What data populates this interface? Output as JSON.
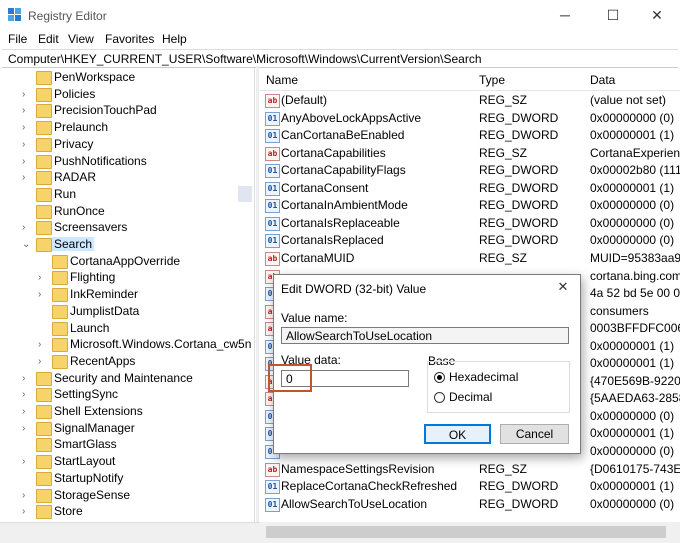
{
  "window": {
    "title": "Registry Editor",
    "minimize": "─",
    "maximize": "☐",
    "close": "✕"
  },
  "menu": [
    "File",
    "Edit",
    "View",
    "Favorites",
    "Help"
  ],
  "address": "Computer\\HKEY_CURRENT_USER\\Software\\Microsoft\\Windows\\CurrentVersion\\Search",
  "tree": [
    {
      "label": "PenWorkspace",
      "level": 0,
      "expandable": false
    },
    {
      "label": "Policies",
      "level": 0,
      "expandable": true
    },
    {
      "label": "PrecisionTouchPad",
      "level": 0,
      "expandable": true
    },
    {
      "label": "Prelaunch",
      "level": 0,
      "expandable": true
    },
    {
      "label": "Privacy",
      "level": 0,
      "expandable": true
    },
    {
      "label": "PushNotifications",
      "level": 0,
      "expandable": true
    },
    {
      "label": "RADAR",
      "level": 0,
      "expandable": true
    },
    {
      "label": "Run",
      "level": 0,
      "expandable": false
    },
    {
      "label": "RunOnce",
      "level": 0,
      "expandable": false
    },
    {
      "label": "Screensavers",
      "level": 0,
      "expandable": true
    },
    {
      "label": "Search",
      "level": 0,
      "expandable": true,
      "expanded": true,
      "selected": true
    },
    {
      "label": "CortanaAppOverride",
      "level": 1,
      "expandable": false
    },
    {
      "label": "Flighting",
      "level": 1,
      "expandable": true
    },
    {
      "label": "InkReminder",
      "level": 1,
      "expandable": true
    },
    {
      "label": "JumplistData",
      "level": 1,
      "expandable": false
    },
    {
      "label": "Launch",
      "level": 1,
      "expandable": false
    },
    {
      "label": "Microsoft.Windows.Cortana_cw5n",
      "level": 1,
      "expandable": true
    },
    {
      "label": "RecentApps",
      "level": 1,
      "expandable": true
    },
    {
      "label": "Security and Maintenance",
      "level": 0,
      "expandable": true
    },
    {
      "label": "SettingSync",
      "level": 0,
      "expandable": true
    },
    {
      "label": "Shell Extensions",
      "level": 0,
      "expandable": true
    },
    {
      "label": "SignalManager",
      "level": 0,
      "expandable": true
    },
    {
      "label": "SmartGlass",
      "level": 0,
      "expandable": false
    },
    {
      "label": "StartLayout",
      "level": 0,
      "expandable": true
    },
    {
      "label": "StartupNotify",
      "level": 0,
      "expandable": false
    },
    {
      "label": "StorageSense",
      "level": 0,
      "expandable": true
    },
    {
      "label": "Store",
      "level": 0,
      "expandable": true
    }
  ],
  "columns": {
    "name": "Name",
    "type": "Type",
    "data": "Data"
  },
  "values": [
    {
      "name": "(Default)",
      "type": "REG_SZ",
      "data": "(value not set)",
      "icon": "sz"
    },
    {
      "name": "AnyAboveLockAppsActive",
      "type": "REG_DWORD",
      "data": "0x00000000 (0)",
      "icon": "dw"
    },
    {
      "name": "CanCortanaBeEnabled",
      "type": "REG_DWORD",
      "data": "0x00000001 (1)",
      "icon": "dw"
    },
    {
      "name": "CortanaCapabilities",
      "type": "REG_SZ",
      "data": "CortanaExperienc",
      "icon": "sz"
    },
    {
      "name": "CortanaCapabilityFlags",
      "type": "REG_DWORD",
      "data": "0x00002b80 (1113",
      "icon": "dw"
    },
    {
      "name": "CortanaConsent",
      "type": "REG_DWORD",
      "data": "0x00000001 (1)",
      "icon": "dw"
    },
    {
      "name": "CortanaInAmbientMode",
      "type": "REG_DWORD",
      "data": "0x00000000 (0)",
      "icon": "dw"
    },
    {
      "name": "CortanaIsReplaceable",
      "type": "REG_DWORD",
      "data": "0x00000000 (0)",
      "icon": "dw"
    },
    {
      "name": "CortanaIsReplaced",
      "type": "REG_DWORD",
      "data": "0x00000000 (0)",
      "icon": "dw"
    },
    {
      "name": "CortanaMUID",
      "type": "REG_SZ",
      "data": "MUID=95383aa98",
      "icon": "sz"
    },
    {
      "name": "",
      "type": "",
      "data": "cortana.bing.com",
      "icon": "sz"
    },
    {
      "name": "",
      "type": "",
      "data": "4a 52 bd 5e 00 0",
      "icon": "dw"
    },
    {
      "name": "",
      "type": "",
      "data": "consumers",
      "icon": "sz"
    },
    {
      "name": "",
      "type": "",
      "data": "0003BFFDFC0067",
      "icon": "sz"
    },
    {
      "name": "",
      "type": "",
      "data": "0x00000001 (1)",
      "icon": "dw"
    },
    {
      "name": "",
      "type": "",
      "data": "0x00000001 (1)",
      "icon": "dw"
    },
    {
      "name": "",
      "type": "",
      "data": "{470E569B-9220-4",
      "icon": "sz"
    },
    {
      "name": "",
      "type": "",
      "data": "{5AAEDA63-2858-",
      "icon": "sz"
    },
    {
      "name": "",
      "type": "",
      "data": "0x00000000 (0)",
      "icon": "dw"
    },
    {
      "name": "",
      "type": "",
      "data": "0x00000001 (1)",
      "icon": "dw"
    },
    {
      "name": "",
      "type": "",
      "data": "0x00000000 (0)",
      "icon": "dw"
    },
    {
      "name": "NamespaceSettingsRevision",
      "type": "REG_SZ",
      "data": "{D0610175-743E-4",
      "icon": "sz"
    },
    {
      "name": "ReplaceCortanaCheckRefreshed",
      "type": "REG_DWORD",
      "data": "0x00000001 (1)",
      "icon": "dw"
    },
    {
      "name": "AllowSearchToUseLocation",
      "type": "REG_DWORD",
      "data": "0x00000000 (0)",
      "icon": "dw"
    }
  ],
  "dialog": {
    "title": "Edit DWORD (32-bit) Value",
    "close": "✕",
    "value_name_label": "Value name:",
    "value_name": "AllowSearchToUseLocation",
    "value_data_label": "Value data:",
    "value_data": "0",
    "base_label": "Base",
    "hex_label": "Hexadecimal",
    "dec_label": "Decimal",
    "selected_base": "Hexadecimal",
    "ok": "OK",
    "cancel": "Cancel"
  },
  "colors": {
    "highlight_border": "#c0562e",
    "accent": "#0078d7",
    "selection": "#cde8ff"
  }
}
